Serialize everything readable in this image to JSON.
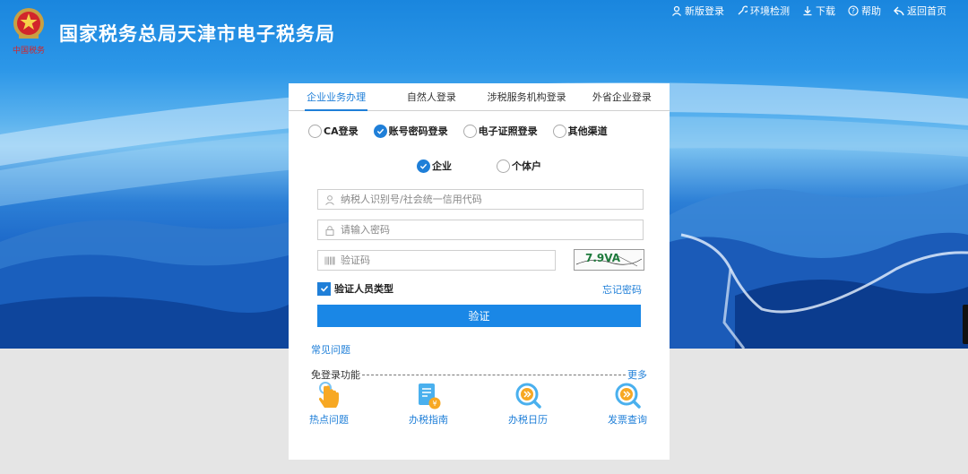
{
  "header": {
    "site_title": "国家税务总局天津市电子税务局",
    "logo_caption": "中国税务",
    "nav": [
      {
        "label": "新版登录",
        "icon": "user-icon"
      },
      {
        "label": "环境检测",
        "icon": "wrench-icon"
      },
      {
        "label": "下载",
        "icon": "download-icon"
      },
      {
        "label": "帮助",
        "icon": "help-icon"
      },
      {
        "label": "返回首页",
        "icon": "back-icon"
      }
    ]
  },
  "login": {
    "tabs": [
      "企业业务办理",
      "自然人登录",
      "涉税服务机构登录",
      "外省企业登录"
    ],
    "active_tab": "企业业务办理",
    "methods": [
      {
        "label": "CA登录",
        "selected": false
      },
      {
        "label": "账号密码登录",
        "selected": true
      },
      {
        "label": "电子证照登录",
        "selected": false
      },
      {
        "label": "其他渠道",
        "selected": false
      }
    ],
    "entity_types": [
      {
        "label": "企业",
        "selected": true
      },
      {
        "label": "个体户",
        "selected": false
      }
    ],
    "taxpayer_id_placeholder": "纳税人识别号/社会统一信用代码",
    "password_placeholder": "请输入密码",
    "captcha_placeholder": "验证码",
    "captcha_text": "7.9VA",
    "verify_type_label": "验证人员类型",
    "verify_type_checked": true,
    "forgot_password": "忘记密码",
    "verify_button": "验证",
    "faq_link": "常见问题",
    "free_login_label": "免登录功能",
    "more_link": "更多",
    "quick_links": [
      {
        "label": "热点问题",
        "icon": "tap-hand-icon"
      },
      {
        "label": "办税指南",
        "icon": "guide-book-icon"
      },
      {
        "label": "办税日历",
        "icon": "calendar-search-icon"
      },
      {
        "label": "发票查询",
        "icon": "invoice-search-icon"
      }
    ]
  },
  "colors": {
    "accent": "#1f7fd8",
    "button": "#1a87e6",
    "panel_bg": "#ffffff",
    "page_bottom": "#e5e5e5"
  }
}
